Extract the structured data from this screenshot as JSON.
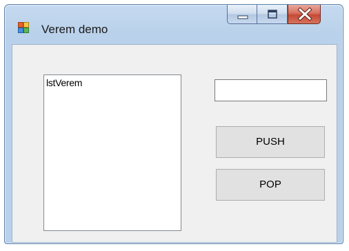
{
  "window": {
    "title": "Verem demo",
    "icon": "winforms-app-icon",
    "caption_buttons": [
      "minimize-icon",
      "maximize-icon",
      "close-icon"
    ]
  },
  "listbox": {
    "items": [
      "lstVerem"
    ]
  },
  "input": {
    "value": ""
  },
  "buttons": {
    "push_label": "PUSH",
    "pop_label": "POP"
  },
  "colors": {
    "window_frame": "#b9d1ea",
    "client_background": "#f0f0f0",
    "button_face": "#e1e1e1",
    "close_button": "#c44a35"
  }
}
